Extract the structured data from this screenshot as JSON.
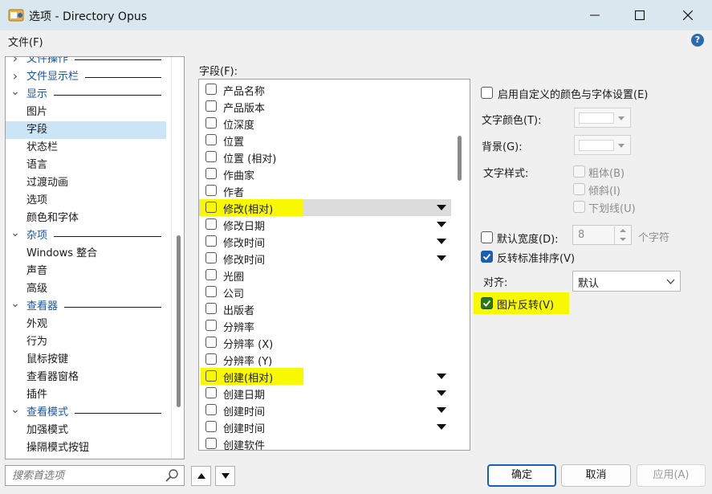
{
  "window": {
    "title": "选项 - Directory Opus"
  },
  "menu": {
    "file": "文件(F)",
    "help": "?"
  },
  "tree": {
    "items": [
      {
        "label": "文件操作",
        "kind": "section",
        "collapsed": true
      },
      {
        "label": "文件显示栏",
        "kind": "section",
        "collapsed": true
      },
      {
        "label": "显示",
        "kind": "section",
        "collapsed": false
      },
      {
        "label": "图片",
        "kind": "child"
      },
      {
        "label": "字段",
        "kind": "child",
        "selected": true
      },
      {
        "label": "状态栏",
        "kind": "child"
      },
      {
        "label": "语言",
        "kind": "child"
      },
      {
        "label": "过渡动画",
        "kind": "child"
      },
      {
        "label": "选项",
        "kind": "child"
      },
      {
        "label": "颜色和字体",
        "kind": "child"
      },
      {
        "label": "杂项",
        "kind": "section",
        "collapsed": false
      },
      {
        "label": "Windows 整合",
        "kind": "child"
      },
      {
        "label": "声音",
        "kind": "child"
      },
      {
        "label": "高级",
        "kind": "child"
      },
      {
        "label": "查看器",
        "kind": "section",
        "collapsed": false
      },
      {
        "label": "外观",
        "kind": "child"
      },
      {
        "label": "行为",
        "kind": "child"
      },
      {
        "label": "鼠标按键",
        "kind": "child"
      },
      {
        "label": "查看器窗格",
        "kind": "child"
      },
      {
        "label": "插件",
        "kind": "child"
      },
      {
        "label": "查看模式",
        "kind": "section",
        "collapsed": false
      },
      {
        "label": "加强模式",
        "kind": "child"
      },
      {
        "label": "操隔模式按钮",
        "kind": "child"
      }
    ]
  },
  "search": {
    "placeholder": "搜索首选项"
  },
  "fields": {
    "label": "字段(F):",
    "items": [
      {
        "label": "产品名称"
      },
      {
        "label": "产品版本"
      },
      {
        "label": "位深度"
      },
      {
        "label": "位置"
      },
      {
        "label": "位置 (相对)"
      },
      {
        "label": "作曲家"
      },
      {
        "label": "作者"
      },
      {
        "label": "修改(相对)",
        "highlight": true,
        "marked": true,
        "dropdown": true
      },
      {
        "label": "修改日期",
        "dropdown": true
      },
      {
        "label": "修改时间",
        "dropdown": true
      },
      {
        "label": "修改时间",
        "dropdown": true
      },
      {
        "label": "光圈"
      },
      {
        "label": "公司"
      },
      {
        "label": "出版者"
      },
      {
        "label": "分辨率"
      },
      {
        "label": "分辨率 (X)"
      },
      {
        "label": "分辨率 (Y)"
      },
      {
        "label": "创建(相对)",
        "marked": true,
        "dropdown": true
      },
      {
        "label": "创建日期",
        "dropdown": true
      },
      {
        "label": "创建时间",
        "dropdown": true
      },
      {
        "label": "创建时间",
        "dropdown": true
      },
      {
        "label": "创建软件"
      }
    ]
  },
  "options": {
    "custom_colors": "启用自定义的颜色与字体设置(E)",
    "text_color": "文字颜色(T):",
    "background": "背景(G):",
    "text_style": "文字样式:",
    "bold": "粗体(B)",
    "italic": "倾斜(I)",
    "underline": "下划线(U)",
    "default_width": "默认宽度(D):",
    "width_value": "8",
    "width_unit": "个字符",
    "reverse_sort": "反转标准排序(V)",
    "align_label": "对齐:",
    "align_value": "默认",
    "image_flip": "图片反转(V)"
  },
  "buttons": {
    "ok": "确定",
    "cancel": "取消",
    "apply": "应用(A)"
  },
  "colors": {
    "accent": "#1a5fb4",
    "highlight": "#f8f800",
    "titlebar": "#d9e7ee"
  }
}
